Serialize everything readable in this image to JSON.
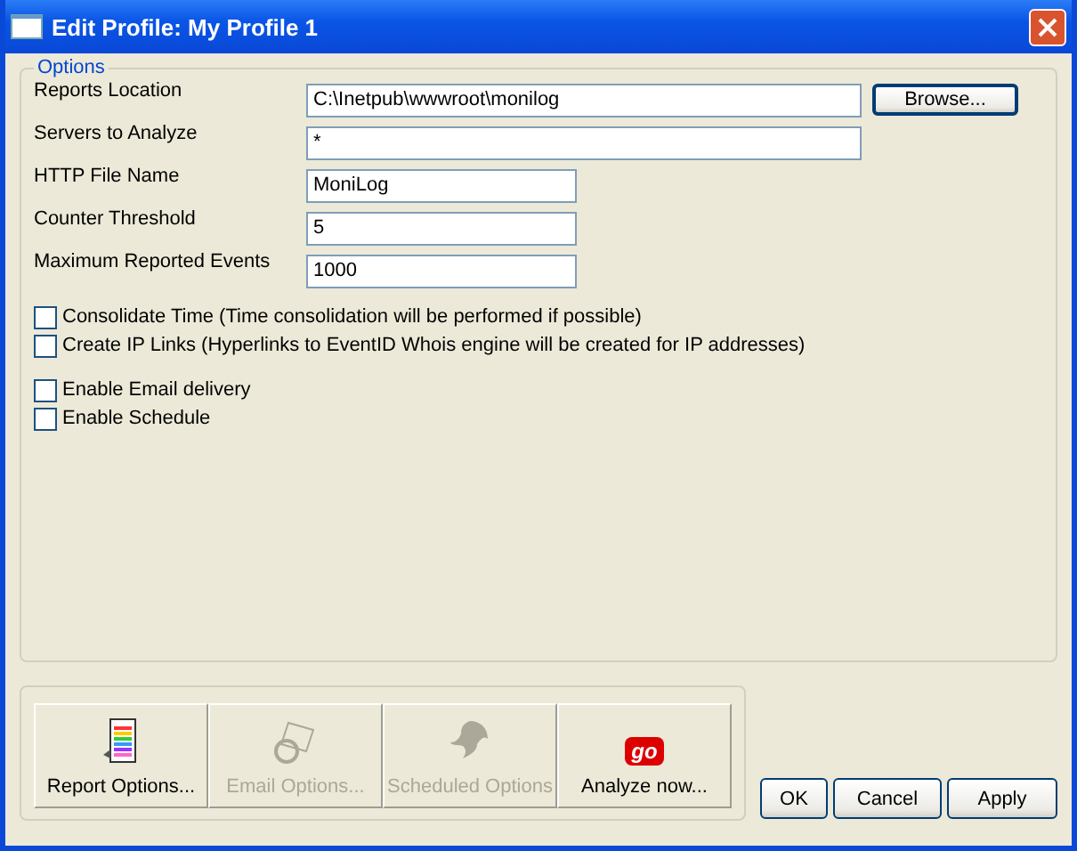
{
  "window": {
    "title": "Edit Profile: My Profile 1"
  },
  "options": {
    "legend": "Options",
    "fields": [
      {
        "label": "Reports Location",
        "value": "C:\\Inetpub\\wwwroot\\monilog",
        "wide": true,
        "button": "Browse..."
      },
      {
        "label": "Servers to Analyze",
        "value": "*",
        "wide": true
      },
      {
        "label": "HTTP File Name",
        "value": "MoniLog",
        "wide": false
      },
      {
        "label": "Counter Threshold",
        "value": "5",
        "wide": false
      },
      {
        "label": "Maximum Reported Events",
        "value": "1000",
        "wide": false
      }
    ],
    "checkbox_groups": [
      [
        {
          "label": "Consolidate Time (Time consolidation will be performed if possible)",
          "checked": false
        },
        {
          "label": "Create IP Links (Hyperlinks to EventID Whois engine will be created for IP addresses)",
          "checked": false
        }
      ],
      [
        {
          "label": "Enable Email delivery",
          "checked": false
        },
        {
          "label": "Enable Schedule",
          "checked": false
        }
      ]
    ]
  },
  "actions": [
    {
      "kind": "report",
      "label": "Report Options...",
      "disabled": false
    },
    {
      "kind": "email",
      "label": "Email Options...",
      "disabled": true
    },
    {
      "kind": "schedule",
      "label": "Scheduled Options",
      "disabled": true
    },
    {
      "kind": "go",
      "label": "Analyze now...",
      "disabled": false,
      "icon_text": "go"
    }
  ],
  "buttons": [
    "OK",
    "Cancel",
    "Apply"
  ]
}
